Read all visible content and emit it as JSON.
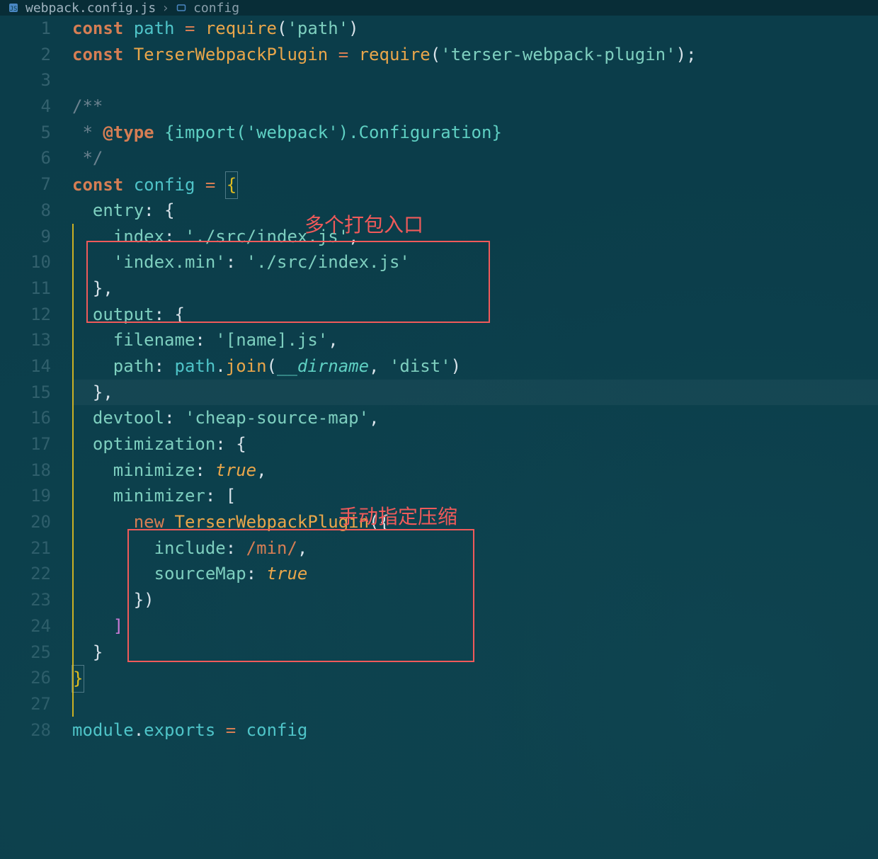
{
  "breadcrumb": {
    "file": "webpack.config.js",
    "separator": "›",
    "symbol": "config"
  },
  "annotations": {
    "box1_label": "多个打包入口",
    "box2_label": "手动指定压缩"
  },
  "line_numbers": [
    "1",
    "2",
    "3",
    "4",
    "5",
    "6",
    "7",
    "8",
    "9",
    "10",
    "11",
    "12",
    "13",
    "14",
    "15",
    "16",
    "17",
    "18",
    "19",
    "20",
    "21",
    "22",
    "23",
    "24",
    "25",
    "26",
    "27",
    "28"
  ],
  "code_lines": {
    "l1": [
      [
        "kw",
        "const"
      ],
      [
        "pun",
        " "
      ],
      [
        "var",
        "path"
      ],
      [
        "pun",
        " "
      ],
      [
        "op",
        "="
      ],
      [
        "pun",
        " "
      ],
      [
        "fn",
        "require"
      ],
      [
        "pun",
        "("
      ],
      [
        "str",
        "'path'"
      ],
      [
        "pun",
        ")"
      ]
    ],
    "l2": [
      [
        "kw",
        "const"
      ],
      [
        "pun",
        " "
      ],
      [
        "cls",
        "TerserWebpackPlugin"
      ],
      [
        "pun",
        " "
      ],
      [
        "op",
        "="
      ],
      [
        "pun",
        " "
      ],
      [
        "fn",
        "require"
      ],
      [
        "pun",
        "("
      ],
      [
        "str",
        "'terser-webpack-plugin'"
      ],
      [
        "pun",
        ")"
      ],
      [
        "pun",
        ";"
      ]
    ],
    "l3": [
      [
        "pun",
        ""
      ]
    ],
    "l4": [
      [
        "com",
        "/**"
      ]
    ],
    "l5": [
      [
        "com",
        " * "
      ],
      [
        "tag",
        "@type"
      ],
      [
        "com",
        " "
      ],
      [
        "type",
        "{import('webpack').Configuration}"
      ]
    ],
    "l6": [
      [
        "com",
        " */"
      ]
    ],
    "l7": [
      [
        "kw",
        "const"
      ],
      [
        "pun",
        " "
      ],
      [
        "var",
        "config"
      ],
      [
        "pun",
        " "
      ],
      [
        "op",
        "="
      ],
      [
        "pun",
        " "
      ],
      [
        "brc-open",
        "{"
      ]
    ],
    "l8": [
      [
        "pun",
        "  "
      ],
      [
        "prop",
        "entry"
      ],
      [
        "pun",
        ": "
      ],
      [
        "pun",
        "{"
      ]
    ],
    "l9": [
      [
        "pun",
        "    "
      ],
      [
        "prop",
        "index"
      ],
      [
        "pun",
        ": "
      ],
      [
        "str",
        "'./src/index.js'"
      ],
      [
        "pun",
        ","
      ]
    ],
    "l10": [
      [
        "pun",
        "    "
      ],
      [
        "str",
        "'index.min'"
      ],
      [
        "pun",
        ": "
      ],
      [
        "str",
        "'./src/index.js'"
      ]
    ],
    "l11": [
      [
        "pun",
        "  "
      ],
      [
        "pun",
        "}"
      ],
      [
        "pun",
        ","
      ]
    ],
    "l12": [
      [
        "pun",
        "  "
      ],
      [
        "prop",
        "output"
      ],
      [
        "pun",
        ": "
      ],
      [
        "pun",
        "{"
      ]
    ],
    "l13": [
      [
        "pun",
        "    "
      ],
      [
        "prop",
        "filename"
      ],
      [
        "pun",
        ": "
      ],
      [
        "str",
        "'[name].js'"
      ],
      [
        "pun",
        ","
      ]
    ],
    "l14": [
      [
        "pun",
        "    "
      ],
      [
        "prop",
        "path"
      ],
      [
        "pun",
        ": "
      ],
      [
        "var",
        "path"
      ],
      [
        "pun",
        "."
      ],
      [
        "fn",
        "join"
      ],
      [
        "pun",
        "("
      ],
      [
        "dir",
        "__dirname"
      ],
      [
        "pun",
        ", "
      ],
      [
        "str",
        "'dist'"
      ],
      [
        "pun",
        ")"
      ]
    ],
    "l15": [
      [
        "pun",
        "  "
      ],
      [
        "pun",
        "}"
      ],
      [
        "pun",
        ","
      ]
    ],
    "l16": [
      [
        "pun",
        "  "
      ],
      [
        "prop",
        "devtool"
      ],
      [
        "pun",
        ": "
      ],
      [
        "str",
        "'cheap-source-map'"
      ],
      [
        "pun",
        ","
      ]
    ],
    "l17": [
      [
        "pun",
        "  "
      ],
      [
        "prop",
        "optimization"
      ],
      [
        "pun",
        ": "
      ],
      [
        "pun",
        "{"
      ]
    ],
    "l18": [
      [
        "pun",
        "    "
      ],
      [
        "prop",
        "minimize"
      ],
      [
        "pun",
        ": "
      ],
      [
        "bool",
        "true"
      ],
      [
        "pun",
        ","
      ]
    ],
    "l19": [
      [
        "pun",
        "    "
      ],
      [
        "prop",
        "minimizer"
      ],
      [
        "pun",
        ": "
      ],
      [
        "pun",
        "["
      ]
    ],
    "l20": [
      [
        "pun",
        "      "
      ],
      [
        "kw2",
        "new"
      ],
      [
        "pun",
        " "
      ],
      [
        "cls",
        "TerserWebpackPlugin"
      ],
      [
        "pun",
        "("
      ],
      [
        "pun",
        "{"
      ]
    ],
    "l21": [
      [
        "pun",
        "        "
      ],
      [
        "prop",
        "include"
      ],
      [
        "pun",
        ": "
      ],
      [
        "rgx",
        "/min/"
      ],
      [
        "pun",
        ","
      ]
    ],
    "l22": [
      [
        "pun",
        "        "
      ],
      [
        "prop",
        "sourceMap"
      ],
      [
        "pun",
        ": "
      ],
      [
        "bool",
        "true"
      ]
    ],
    "l23": [
      [
        "pun",
        "      "
      ],
      [
        "pun",
        "}"
      ],
      [
        "pun",
        ")"
      ]
    ],
    "l24": [
      [
        "pun",
        "    "
      ],
      [
        "brk",
        "]"
      ]
    ],
    "l25": [
      [
        "pun",
        "  "
      ],
      [
        "pun",
        "}"
      ]
    ],
    "l26": [
      [
        "brc-close",
        "}"
      ]
    ],
    "l27": [
      [
        "pun",
        ""
      ]
    ],
    "l28": [
      [
        "var",
        "module"
      ],
      [
        "pun",
        "."
      ],
      [
        "var",
        "exports"
      ],
      [
        "pun",
        " "
      ],
      [
        "op",
        "="
      ],
      [
        "pun",
        " "
      ],
      [
        "var",
        "config"
      ]
    ]
  }
}
